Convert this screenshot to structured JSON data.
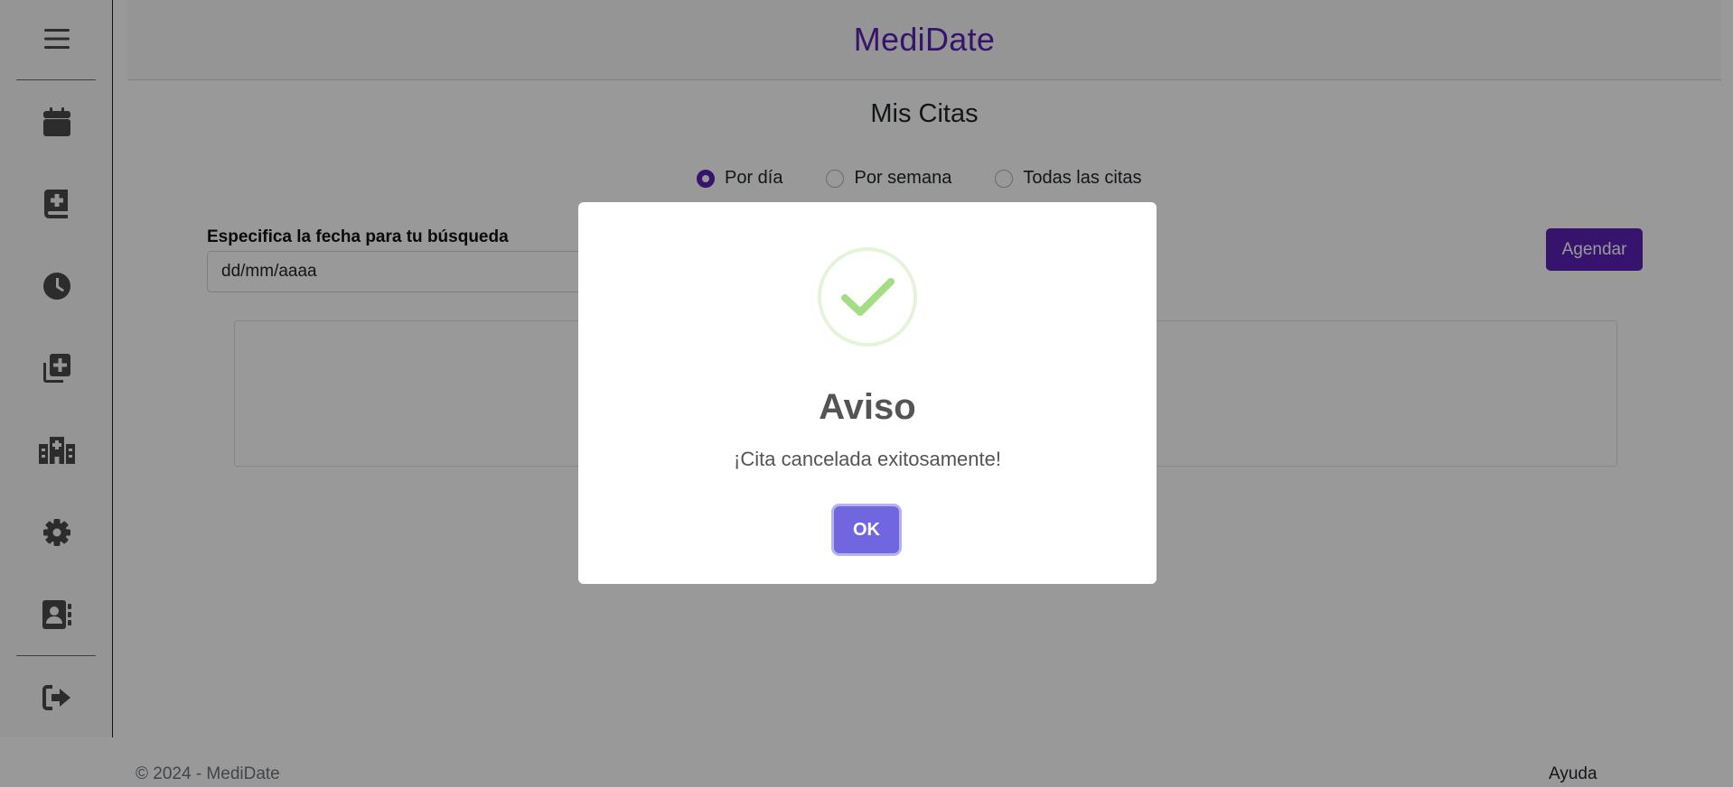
{
  "app": {
    "brand": "MediDate"
  },
  "sidebar": {
    "items": [
      {
        "icon": "menu-icon"
      },
      {
        "icon": "calendar-icon"
      },
      {
        "icon": "medical-book-icon"
      },
      {
        "icon": "clock-icon"
      },
      {
        "icon": "add-copy-icon"
      },
      {
        "icon": "hospital-icon"
      },
      {
        "icon": "gear-icon"
      },
      {
        "icon": "contact-book-icon"
      },
      {
        "icon": "logout-icon"
      }
    ]
  },
  "main": {
    "title": "Mis Citas",
    "filters": [
      {
        "label": "Por día",
        "selected": true
      },
      {
        "label": "Por semana",
        "selected": false
      },
      {
        "label": "Todas las citas",
        "selected": false
      }
    ],
    "date_label": "Especifica la fecha para tu búsqueda",
    "date_placeholder": "dd/mm/aaaa",
    "schedule_button": "Agendar"
  },
  "footer": {
    "copyright": "© 2024 - MediDate",
    "help": "Ayuda"
  },
  "modal": {
    "title": "Aviso",
    "message": "¡Cita cancelada exitosamente!",
    "ok": "OK",
    "icon": "success-check-icon",
    "icon_color": "#a5dc86",
    "button_color": "#7066e0"
  },
  "colors": {
    "accent": "#5b21b6"
  }
}
